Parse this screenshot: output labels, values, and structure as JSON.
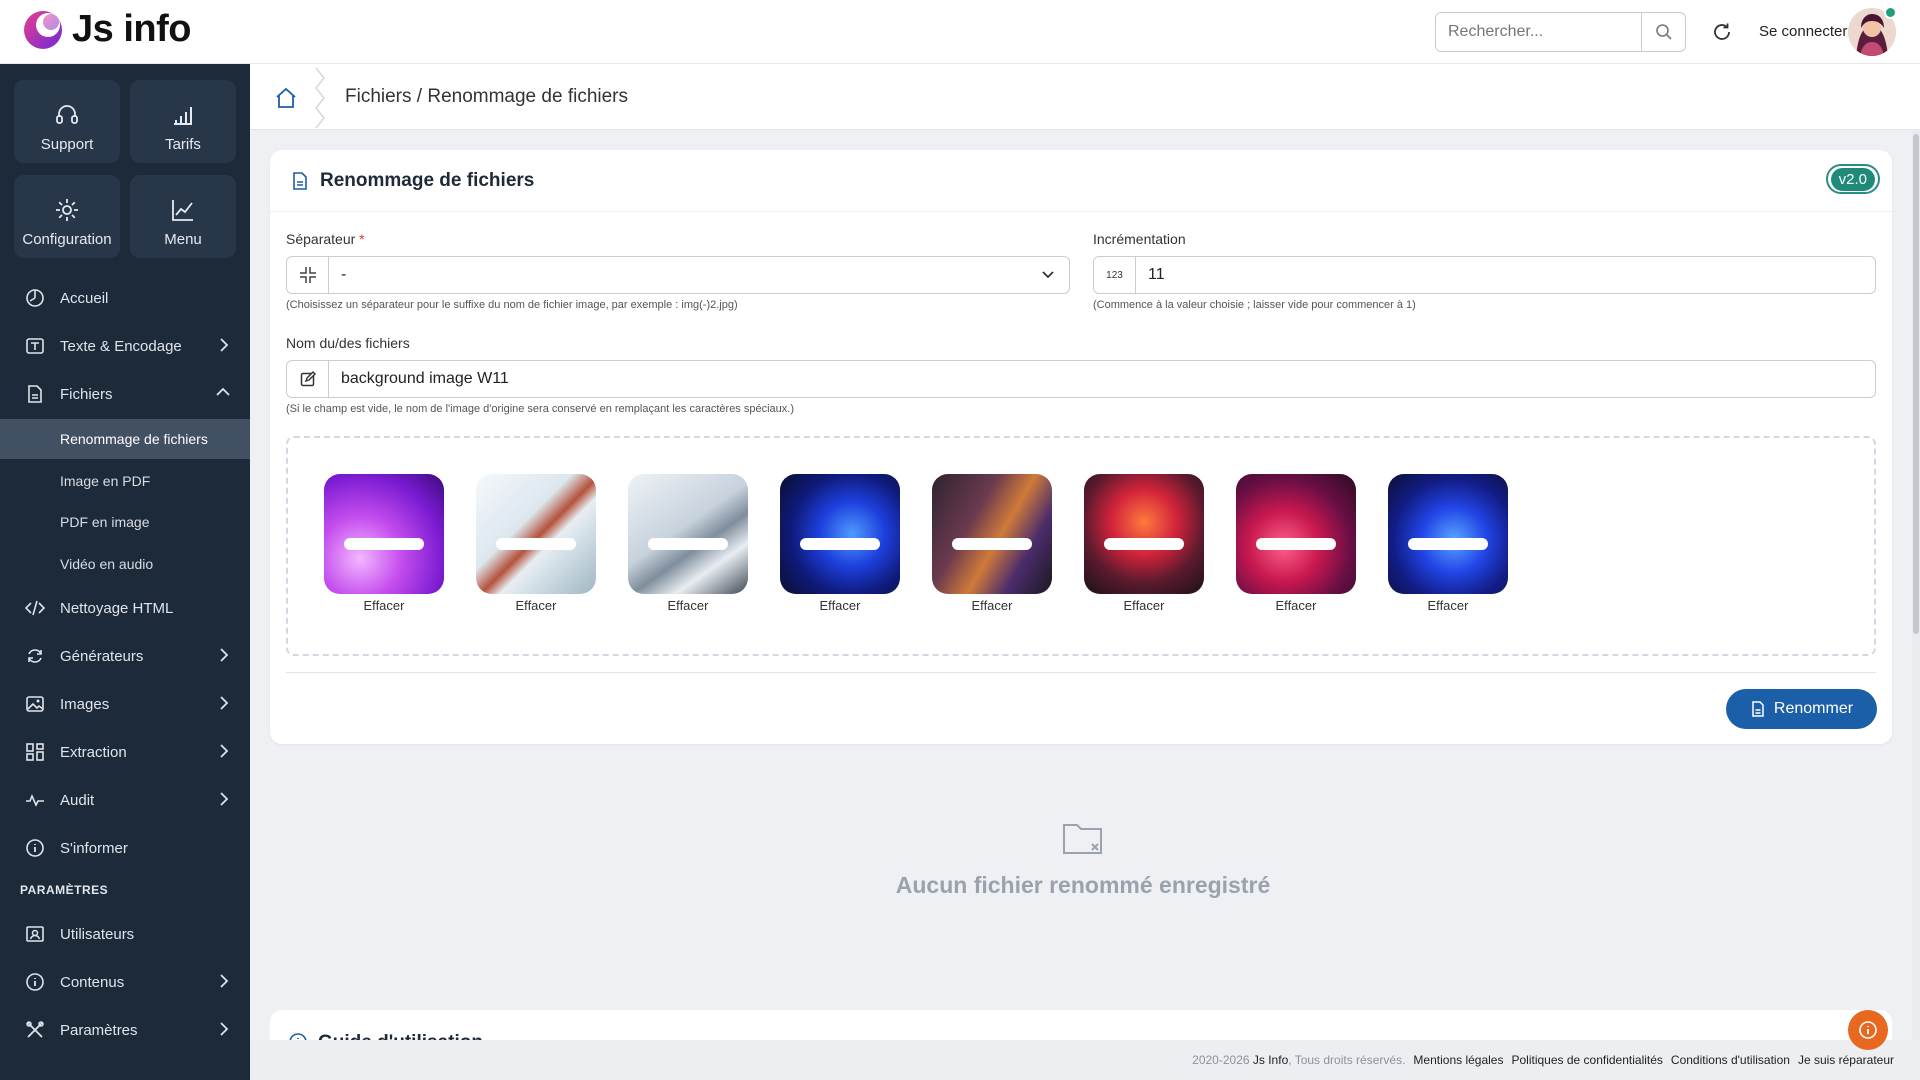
{
  "app": {
    "title": "Js info"
  },
  "header": {
    "search_placeholder": "Rechercher...",
    "login_label": "Se connecter"
  },
  "sidebar": {
    "tiles": [
      {
        "label": "Support",
        "icon": "headset-icon"
      },
      {
        "label": "Tarifs",
        "icon": "bar-chart-icon"
      },
      {
        "label": "Configuration",
        "icon": "gear-icon"
      },
      {
        "label": "Menu",
        "icon": "chart-line-icon"
      }
    ],
    "items": [
      {
        "label": "Accueil",
        "icon": "dashboard-icon"
      },
      {
        "label": "Texte & Encodage",
        "icon": "text-icon"
      },
      {
        "label": "Fichiers",
        "icon": "file-icon"
      },
      {
        "label": "Nettoyage HTML",
        "icon": "code-icon"
      },
      {
        "label": "Générateurs",
        "icon": "sync-icon"
      },
      {
        "label": "Images",
        "icon": "image-icon"
      },
      {
        "label": "Extraction",
        "icon": "grid-icon"
      },
      {
        "label": "Audit",
        "icon": "pulse-icon"
      },
      {
        "label": "S'informer",
        "icon": "info-icon"
      }
    ],
    "sub_items": [
      "Renommage de fichiers",
      "Image en PDF",
      "PDF en image",
      "Vidéo en audio"
    ],
    "section_label": "PARAMÈTRES",
    "settings_items": [
      {
        "label": "Utilisateurs",
        "icon": "user-card-icon"
      },
      {
        "label": "Contenus",
        "icon": "info-icon"
      },
      {
        "label": "Paramètres",
        "icon": "tools-icon"
      }
    ]
  },
  "breadcrumb": {
    "text": "Fichiers / Renommage de fichiers"
  },
  "form": {
    "title": "Renommage de fichiers",
    "version": "v2.0",
    "separator": {
      "label": "Séparateur",
      "required_mark": "*",
      "value": "-",
      "hint": "(Choisissez un séparateur pour le suffixe du nom de fichier image, par exemple : img(-)2.jpg)"
    },
    "increment": {
      "label": "Incrémentation",
      "prefix": "123",
      "value": "11",
      "hint": "(Commence à la valeur choisie ; laisser vide pour commencer à 1)"
    },
    "filename": {
      "label": "Nom du/des fichiers",
      "value": "background image W11",
      "hint": "(Si le champ est vide, le nom de l'image d'origine sera conservé en remplaçant les caractères spéciaux.)"
    },
    "images": [
      {
        "label": "Effacer"
      },
      {
        "label": "Effacer"
      },
      {
        "label": "Effacer"
      },
      {
        "label": "Effacer"
      },
      {
        "label": "Effacer"
      },
      {
        "label": "Effacer"
      },
      {
        "label": "Effacer"
      },
      {
        "label": "Effacer"
      }
    ],
    "rename_button": "Renommer"
  },
  "empty_state": {
    "text": "Aucun fichier renommé enregistré"
  },
  "guide": {
    "title": "Guide d'utilisation"
  },
  "footer": {
    "copyright_years": "2020-2026",
    "brand": "Js Info",
    "rights": ", Tous droits réservés.",
    "links": [
      "Mentions légales",
      "Politiques de confidentialités",
      "Conditions d'utilisation",
      "Je suis réparateur"
    ]
  },
  "colors": {
    "sidebar_bg": "#1d2a3a",
    "accent": "#1b5fa8",
    "version_badge": "#1f8a7a",
    "fab": "#e8681f"
  }
}
